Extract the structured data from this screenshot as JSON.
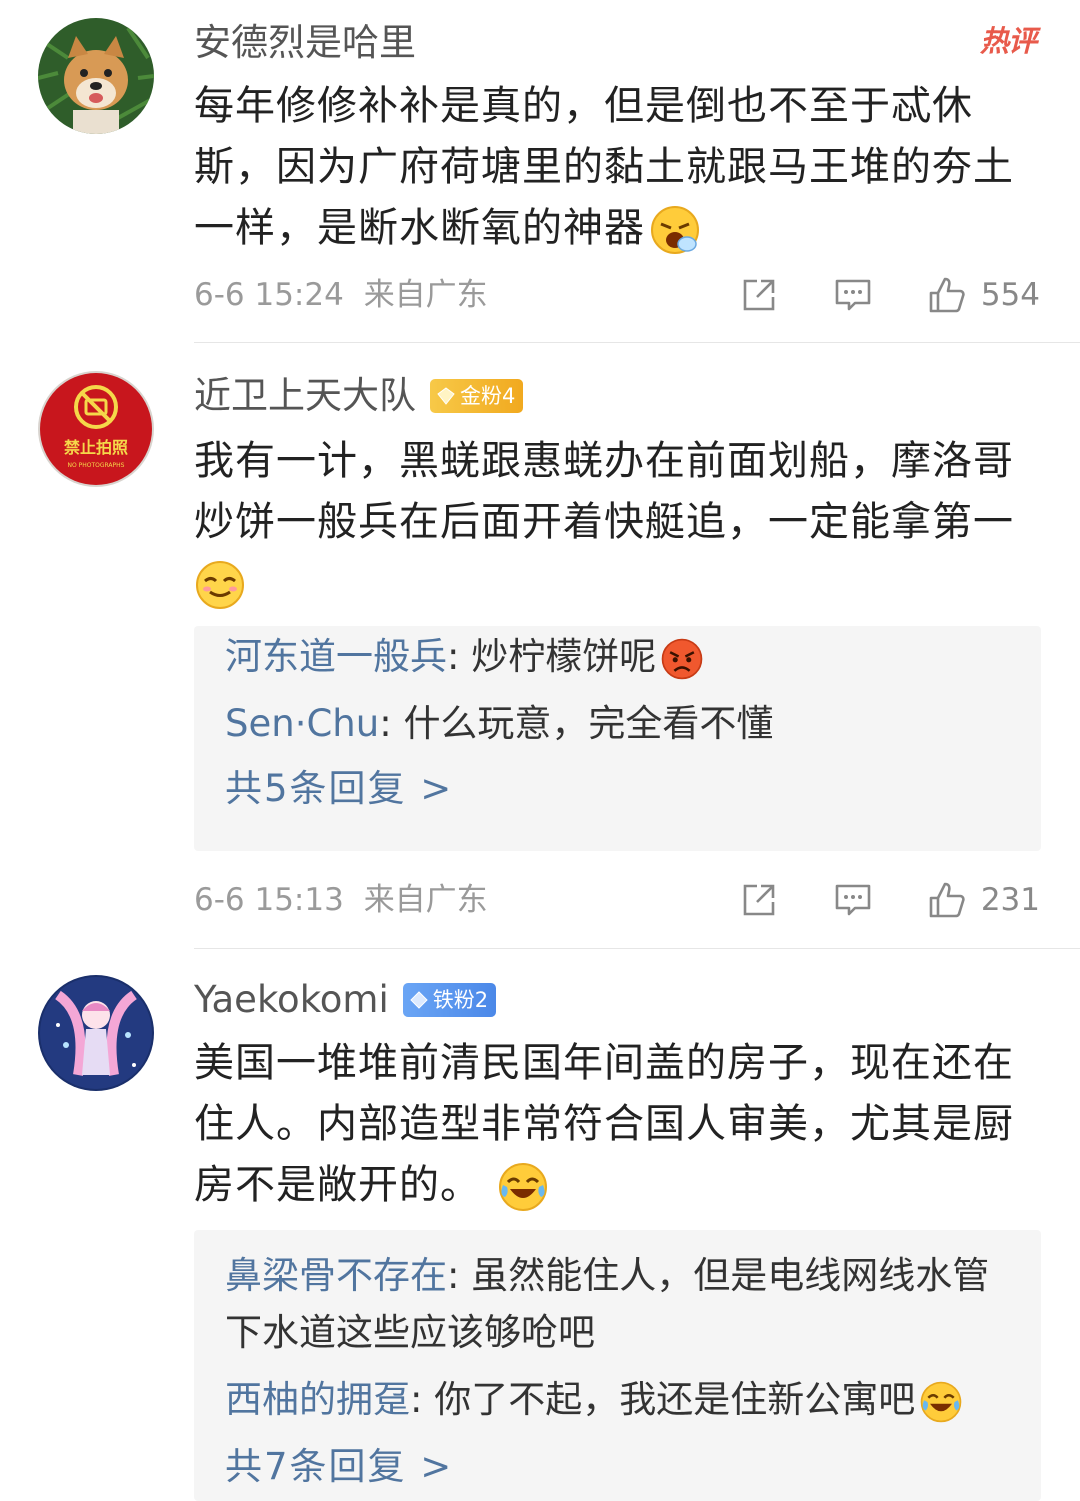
{
  "hot_label": "热评",
  "comments": [
    {
      "username": "安德烈是哈里",
      "text": "每年修修补补是真的，但是倒也不至于忒休斯，因为广府荷塘里的黏土就跟马王堆的夯土一样，是断水断氧的神器",
      "emoji": "crying-laughing-emoji",
      "time": "6-6 15:24",
      "location": "来自广东",
      "likes": "554"
    },
    {
      "username": "近卫上天大队",
      "badge": "金粉4",
      "avatar_sign_cn": "禁止拍照",
      "avatar_sign_en": "NO PHOTOGRAPHS",
      "text": "我有一计，黑蜣跟惠蜣办在前面划船，摩洛哥炒饼一般兵在后面开着快艇追，一定能拿第一",
      "emoji": "smug-emoji",
      "replies": [
        {
          "user": "河东道一般兵",
          "sep": ": ",
          "text": "炒柠檬饼呢",
          "emoji": "angry-emoji"
        },
        {
          "user": "Sen·Chu",
          "sep": ": ",
          "text": "什么玩意，完全看不懂"
        }
      ],
      "more_replies": "共5条回复 >",
      "time": "6-6 15:13",
      "location": "来自广东",
      "likes": "231"
    },
    {
      "username": "Yaekokomi",
      "badge": "铁粉2",
      "text": "美国一堆堆前清民国年间盖的房子，现在还在住人。内部造型非常符合国人审美，尤其是厨房不是敞开的。",
      "emoji": "laughing-tears-emoji",
      "replies": [
        {
          "user": "鼻梁骨不存在",
          "sep": ": ",
          "text": "虽然能住人，但是电线网线水管下水道这些应该够呛吧"
        },
        {
          "user": "西柚的拥趸",
          "sep": ": ",
          "text": "你了不起，我还是住新公寓吧",
          "emoji": "laughing-tears-emoji"
        }
      ],
      "more_replies": "共7条回复 >"
    }
  ],
  "colors": {
    "link_blue": "#51759f",
    "hot_red": "#e85a4b",
    "gold_badge": "#f1a91f",
    "blue_badge": "#4b88e8",
    "reply_bg": "#f5f5f5"
  }
}
